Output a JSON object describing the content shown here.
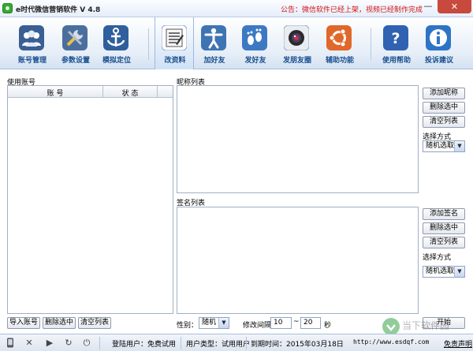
{
  "window": {
    "title": "e时代微信营销软件  V 4.8",
    "announcement": "公告：微信软件已经上架，视频已经制作完成",
    "minimize": "—",
    "close": "✕"
  },
  "toolbar": {
    "items": [
      {
        "label": "账号管理",
        "icon": "users-icon"
      },
      {
        "label": "参数设置",
        "icon": "tools-icon"
      },
      {
        "label": "模拟定位",
        "icon": "anchor-icon"
      },
      {
        "label": "改资料",
        "icon": "notepad-icon"
      },
      {
        "label": "加好友",
        "icon": "person-icon"
      },
      {
        "label": "发好友",
        "icon": "footprint-icon"
      },
      {
        "label": "发朋友圈",
        "icon": "camera-icon"
      },
      {
        "label": "辅助功能",
        "icon": "ubuntu-icon"
      },
      {
        "label": "使用帮助",
        "icon": "help-icon"
      },
      {
        "label": "投诉建议",
        "icon": "info-icon"
      }
    ],
    "selected": "改资料"
  },
  "accounts": {
    "title": "使用账号",
    "col_account": "账  号",
    "col_status": "状  态",
    "import": "导入账号",
    "delete": "删除选中",
    "clear": "清空列表"
  },
  "nickname": {
    "title": "昵称列表",
    "add": "添加昵称",
    "delete": "删除选中",
    "clear": "清空列表",
    "mode_label": "选择方式",
    "mode_value": "随机选取"
  },
  "signature": {
    "title": "签名列表",
    "add": "添加签名",
    "delete": "删除选中",
    "clear": "清空列表",
    "mode_label": "选择方式",
    "mode_value": "随机选取"
  },
  "controls": {
    "gender_label": "性别：",
    "gender_value": "随机",
    "interval_label": "修改间隔",
    "interval_from": "10",
    "tilde": "~",
    "interval_to": "20",
    "unit": "秒",
    "start": "开始"
  },
  "status": {
    "login_user": "登陆用户：免费试用",
    "user_type": "用户类型：试用用户",
    "expire": "到期时间：2015年03月18日",
    "site": "http://www.esdqf.com",
    "disclaimer": "免责声明"
  },
  "watermark": {
    "text1": "当下软件园",
    "text2": "www.downxia.com"
  },
  "colors": {
    "accent": "#1a4f8f",
    "close": "#c74a3d",
    "announce": "#d11414"
  }
}
